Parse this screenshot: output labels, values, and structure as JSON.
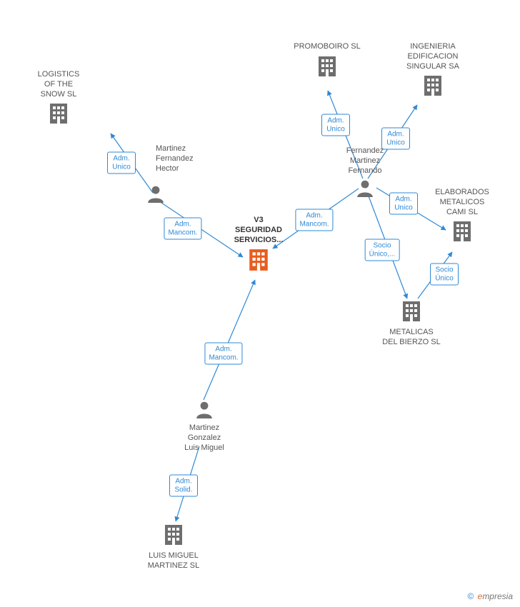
{
  "entities": {
    "logistics": {
      "label": "LOGISTICS\nOF THE\nSNOW SL"
    },
    "promoboiro": {
      "label": "PROMOBOIRO SL"
    },
    "ingenieria": {
      "label": "INGENIERIA\nEDIFICACION\nSINGULAR SA"
    },
    "elaborados": {
      "label": "ELABORADOS\nMETALICOS\nCAMI SL"
    },
    "metalicas": {
      "label": "METALICAS\nDEL BIERZO  SL"
    },
    "luismiguel_co": {
      "label": "LUIS MIGUEL\nMARTINEZ SL"
    },
    "v3": {
      "label": "V3\nSEGURIDAD\nSERVICIOS..."
    },
    "hector": {
      "label": "Martinez\nFernandez\nHector"
    },
    "fernando": {
      "label": "Fernandez\nMartinez\nFernando"
    },
    "luismiguel_p": {
      "label": "Martinez\nGonzalez\nLuis Miguel"
    }
  },
  "edges": {
    "adm_unico": "Adm.\nUnico",
    "adm_mancom": "Adm.\nMancom.",
    "adm_solid": "Adm.\nSolid.",
    "socio_unico": "Socio\nÚnico",
    "socio_unico_ellipsis": "Socio\nÚnico,..."
  },
  "watermark": {
    "symbol": "©",
    "brand_e": "e",
    "brand_rest": "mpresia"
  },
  "colors": {
    "edge": "#2F89D6",
    "company": "#6E6E6E",
    "center": "#E85C1E",
    "person": "#6E6E6E"
  }
}
